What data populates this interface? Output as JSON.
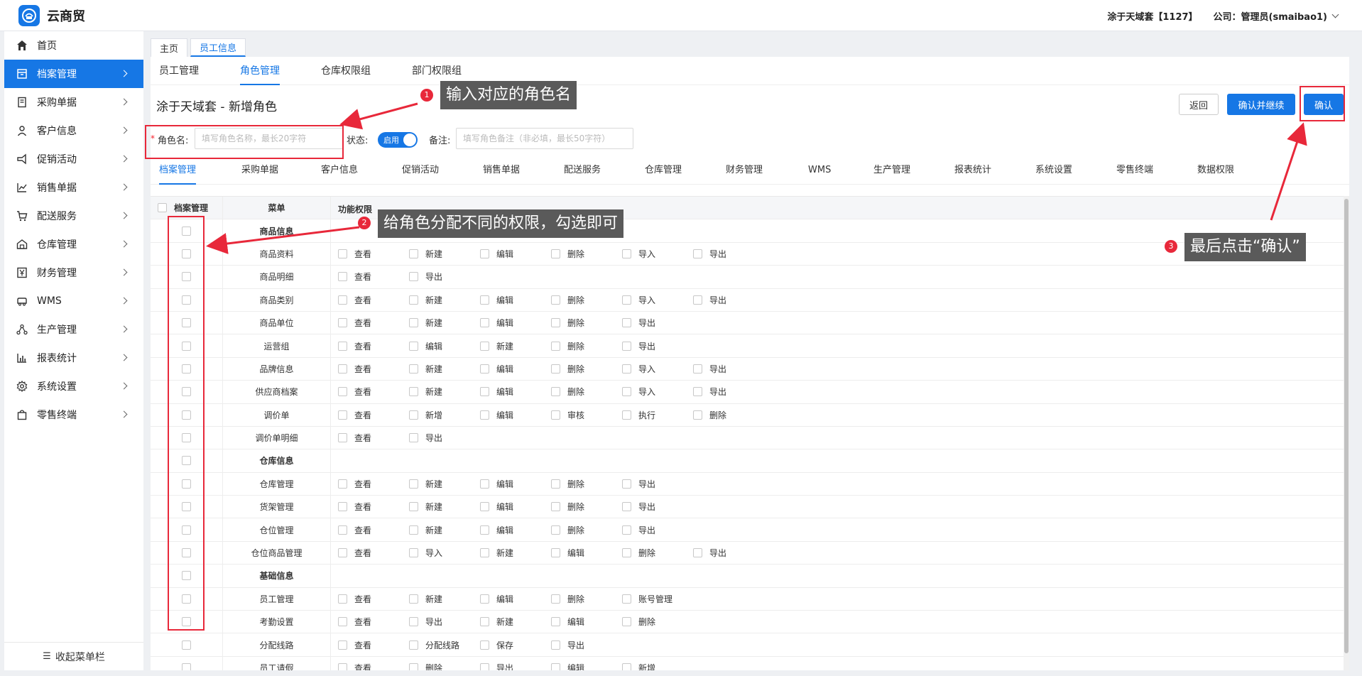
{
  "app": {
    "name": "云商贸"
  },
  "header": {
    "account": "涂于天域套【1127】",
    "company": "公司：管理员(smaibao1)"
  },
  "sidebar": {
    "items": [
      {
        "label": "首页",
        "icon": "home-icon"
      },
      {
        "label": "档案管理",
        "icon": "archive-icon",
        "active": true
      },
      {
        "label": "采购单据",
        "icon": "receipt-icon"
      },
      {
        "label": "客户信息",
        "icon": "user-icon"
      },
      {
        "label": "促销活动",
        "icon": "megaphone-icon"
      },
      {
        "label": "销售单据",
        "icon": "chart-line-icon"
      },
      {
        "label": "配送服务",
        "icon": "cart-icon"
      },
      {
        "label": "仓库管理",
        "icon": "warehouse-icon"
      },
      {
        "label": "财务管理",
        "icon": "yen-icon"
      },
      {
        "label": "WMS",
        "icon": "truck-icon"
      },
      {
        "label": "生产管理",
        "icon": "nodes-icon"
      },
      {
        "label": "报表统计",
        "icon": "bar-chart-icon"
      },
      {
        "label": "系统设置",
        "icon": "gear-icon"
      },
      {
        "label": "零售终端",
        "icon": "bag-icon"
      }
    ],
    "collapse_label": "收起菜单栏"
  },
  "page_tabs": [
    "主页",
    "员工信息"
  ],
  "sub_tabs": [
    "员工管理",
    "角色管理",
    "仓库权限组",
    "部门权限组"
  ],
  "page_title": "涂于天域套 - 新增角色",
  "buttons": {
    "back": "返回",
    "confirm_continue": "确认并继续",
    "confirm": "确认"
  },
  "form": {
    "role_label": "角色名:",
    "role_placeholder": "填写角色名称，最长20字符",
    "status_label": "状态:",
    "status_value": "启用",
    "remark_label": "备注:",
    "remark_placeholder": "填写角色备注（非必填，最长50字符）"
  },
  "perm_tabs": [
    "档案管理",
    "采购单据",
    "客户信息",
    "促销活动",
    "销售单据",
    "配送服务",
    "仓库管理",
    "财务管理",
    "WMS",
    "生产管理",
    "报表统计",
    "系统设置",
    "零售终端",
    "数据权限"
  ],
  "table": {
    "headers": {
      "check": "档案管理",
      "menu": "菜单",
      "perms": "功能权限"
    },
    "rows": [
      {
        "menu": "商品信息",
        "group": true,
        "perms": []
      },
      {
        "menu": "商品资料",
        "perms": [
          "查看",
          "新建",
          "编辑",
          "删除",
          "导入",
          "导出"
        ]
      },
      {
        "menu": "商品明细",
        "perms": [
          "查看",
          "导出"
        ]
      },
      {
        "menu": "商品类别",
        "perms": [
          "查看",
          "新建",
          "编辑",
          "删除",
          "导入",
          "导出"
        ]
      },
      {
        "menu": "商品单位",
        "perms": [
          "查看",
          "新建",
          "编辑",
          "删除",
          "导出"
        ]
      },
      {
        "menu": "运营组",
        "perms": [
          "查看",
          "编辑",
          "新建",
          "删除",
          "导出"
        ]
      },
      {
        "menu": "品牌信息",
        "perms": [
          "查看",
          "新建",
          "编辑",
          "删除",
          "导入",
          "导出"
        ]
      },
      {
        "menu": "供应商档案",
        "perms": [
          "查看",
          "新建",
          "编辑",
          "删除",
          "导入",
          "导出"
        ]
      },
      {
        "menu": "调价单",
        "perms": [
          "查看",
          "新增",
          "编辑",
          "审核",
          "执行",
          "删除"
        ]
      },
      {
        "menu": "调价单明细",
        "perms": [
          "查看",
          "导出"
        ]
      },
      {
        "menu": "仓库信息",
        "group": true,
        "perms": []
      },
      {
        "menu": "仓库管理",
        "perms": [
          "查看",
          "新建",
          "编辑",
          "删除",
          "导出"
        ]
      },
      {
        "menu": "货架管理",
        "perms": [
          "查看",
          "新建",
          "编辑",
          "删除",
          "导出"
        ]
      },
      {
        "menu": "仓位管理",
        "perms": [
          "查看",
          "新建",
          "编辑",
          "删除",
          "导出"
        ]
      },
      {
        "menu": "仓位商品管理",
        "perms": [
          "查看",
          "导入",
          "新建",
          "编辑",
          "删除",
          "导出"
        ]
      },
      {
        "menu": "基础信息",
        "group": true,
        "perms": []
      },
      {
        "menu": "员工管理",
        "perms": [
          "查看",
          "新建",
          "编辑",
          "删除",
          "账号管理"
        ]
      },
      {
        "menu": "考勤设置",
        "perms": [
          "查看",
          "导出",
          "新建",
          "编辑",
          "删除"
        ]
      },
      {
        "menu": "分配线路",
        "perms": [
          "查看",
          "分配线路",
          "保存",
          "导出"
        ]
      },
      {
        "menu": "员工请假",
        "perms": [
          "查看",
          "删除",
          "导出",
          "编辑",
          "新增"
        ]
      }
    ]
  },
  "annotations": [
    {
      "num": "1",
      "text": "输入对应的角色名"
    },
    {
      "num": "2",
      "text": "给角色分配不同的权限，勾选即可"
    },
    {
      "num": "3",
      "text": "最后点击“确认”"
    }
  ],
  "colors": {
    "primary": "#1677e5",
    "annotation_red": "#e8283a",
    "callout_bg": "#5a5a5a"
  }
}
